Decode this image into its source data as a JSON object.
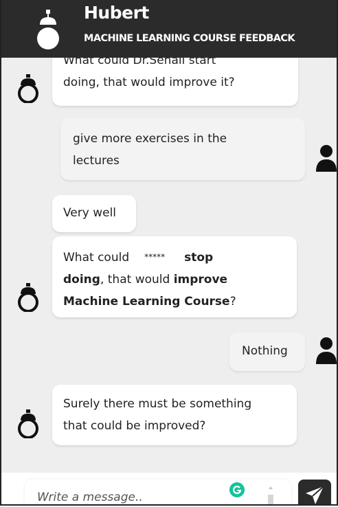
{
  "header": {
    "title": "Hubert",
    "subtitle": "MACHINE LEARNING COURSE FEEDBACK"
  },
  "messages": [
    {
      "sender": "bot",
      "line1": "What could Dr.Sehail start",
      "line2": "doing, that would improve it?"
    },
    {
      "sender": "user",
      "line1": "give more exercises in the",
      "line2": "lectures"
    },
    {
      "sender": "bot",
      "text": "Very well"
    },
    {
      "sender": "bot",
      "l1a": "What could",
      "l1b": "*****",
      "l1c": "stop",
      "l2a": "doing",
      "l2b": ", that would ",
      "l2c": "improve",
      "l3a": "Machine Learning Course",
      "l3b": "?"
    },
    {
      "sender": "user",
      "text": "Nothing"
    },
    {
      "sender": "bot",
      "line1": "Surely there must be something",
      "line2": "that could be improved?"
    }
  ],
  "composer": {
    "placeholder": "Write a message.."
  },
  "colors": {
    "header_bg": "#2b2b2b",
    "chat_bg": "#eeeeee",
    "bubble_bg": "#ffffff",
    "grammarly_green": "#15c39a"
  },
  "icons": {
    "bot_avatar": "robot-icon",
    "user_avatar": "person-icon",
    "send": "paper-plane-icon",
    "grammarly": "grammarly-icon"
  }
}
